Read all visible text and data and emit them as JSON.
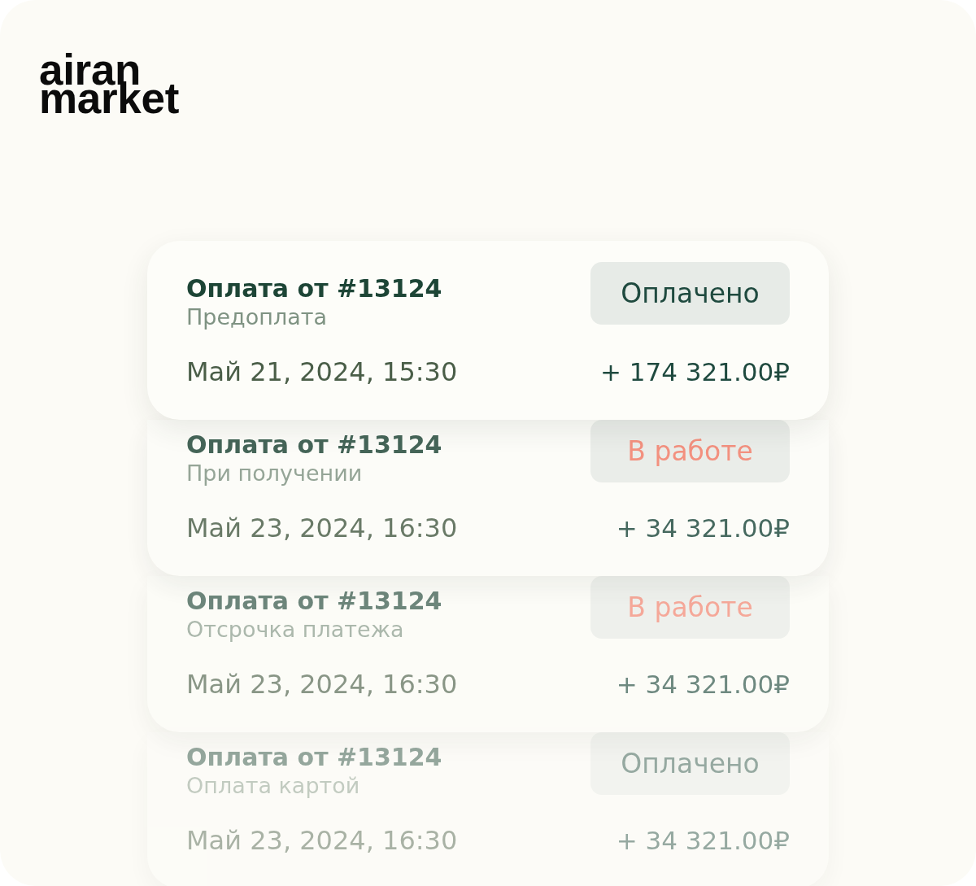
{
  "logo": "airan market",
  "payments": [
    {
      "title": "Оплата от #13124",
      "subtitle": "Предоплата",
      "status": {
        "label": "Оплачено",
        "kind": "paid"
      },
      "date": "Май 21, 2024, 15:30",
      "amount": "+ 174 321.00₽"
    },
    {
      "title": "Оплата от #13124",
      "subtitle": "При получении",
      "status": {
        "label": "В работе",
        "kind": "in_progress"
      },
      "date": "Май 23, 2024, 16:30",
      "amount": "+ 34 321.00₽"
    },
    {
      "title": "Оплата от #13124",
      "subtitle": "Отсрочка платежа",
      "status": {
        "label": "В работе",
        "kind": "in_progress"
      },
      "date": "Май 23, 2024, 16:30",
      "amount": "+ 34 321.00₽"
    },
    {
      "title": "Оплата от #13124",
      "subtitle": "Оплата картой",
      "status": {
        "label": "Оплачено",
        "kind": "paid"
      },
      "date": "Май 23, 2024, 16:30",
      "amount": "+ 34 321.00₽"
    }
  ]
}
